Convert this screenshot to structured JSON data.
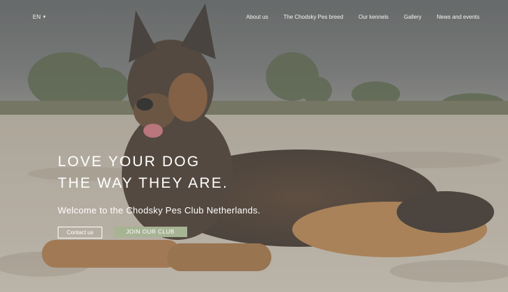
{
  "language": {
    "current": "EN",
    "caret_icon": "caret-down-icon"
  },
  "nav": {
    "items": [
      {
        "label": "About us"
      },
      {
        "label": "The Chodsky Pes breed"
      },
      {
        "label": "Our kennels"
      },
      {
        "label": "Gallery"
      },
      {
        "label": "News and events"
      }
    ]
  },
  "hero": {
    "headline_line1": "LOVE YOUR DOG",
    "headline_line2": "THE WAY THEY ARE.",
    "welcome_text": "Welcome to the Chodsky Pes Club Netherlands.",
    "contact_button": "Contact us",
    "join_button": "JOIN OUR CLUB"
  },
  "colors": {
    "join_button_bg": "#a7b494",
    "text": "#ffffff",
    "sky": "#5b5d5f",
    "sand": "#c8beb0"
  }
}
